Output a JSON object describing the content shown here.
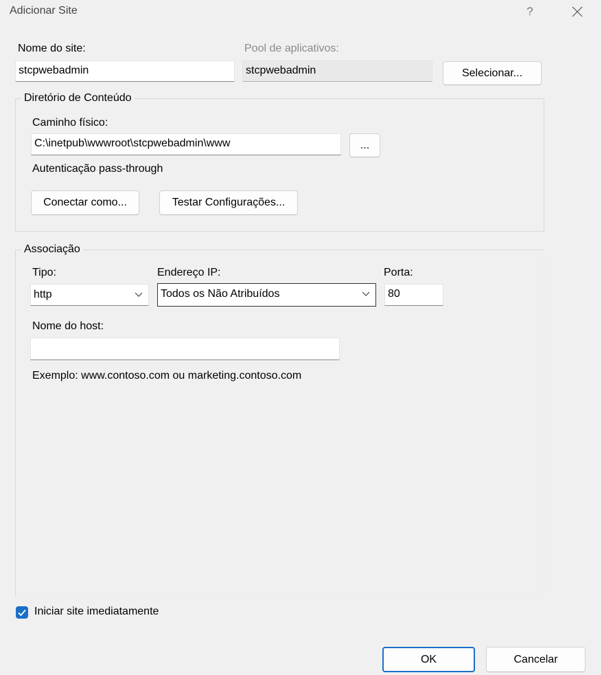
{
  "window": {
    "title": "Adicionar Site",
    "help_glyph": "?",
    "close_icon": "close-icon"
  },
  "site": {
    "name_label": "Nome do site:",
    "name_value": "stcpwebadmin",
    "pool_label": "Pool de aplicativos:",
    "pool_value": "stcpwebadmin",
    "select_button": "Selecionar..."
  },
  "content_dir": {
    "group_title": "Diretório de Conteúdo",
    "path_label": "Caminho físico:",
    "path_value": "C:\\inetpub\\wwwroot\\stcpwebadmin\\www",
    "browse_button": "...",
    "auth_text": "Autenticação pass-through",
    "connect_button": "Conectar como...",
    "test_button": "Testar Configurações..."
  },
  "binding": {
    "group_title": "Associação",
    "type_label": "Tipo:",
    "type_value": "http",
    "ip_label": "Endereço IP:",
    "ip_value": "Todos os Não Atribuídos",
    "port_label": "Porta:",
    "port_value": "80",
    "host_label": "Nome do host:",
    "host_value": "",
    "example_text": "Exemplo: www.contoso.com ou marketing.contoso.com"
  },
  "start_site": {
    "label": "Iniciar site imediatamente",
    "checked": true
  },
  "footer": {
    "ok_button": "OK",
    "cancel_button": "Cancelar"
  },
  "colors": {
    "accent": "#1a6fc7",
    "dialog_bg": "#f0f0f0"
  }
}
